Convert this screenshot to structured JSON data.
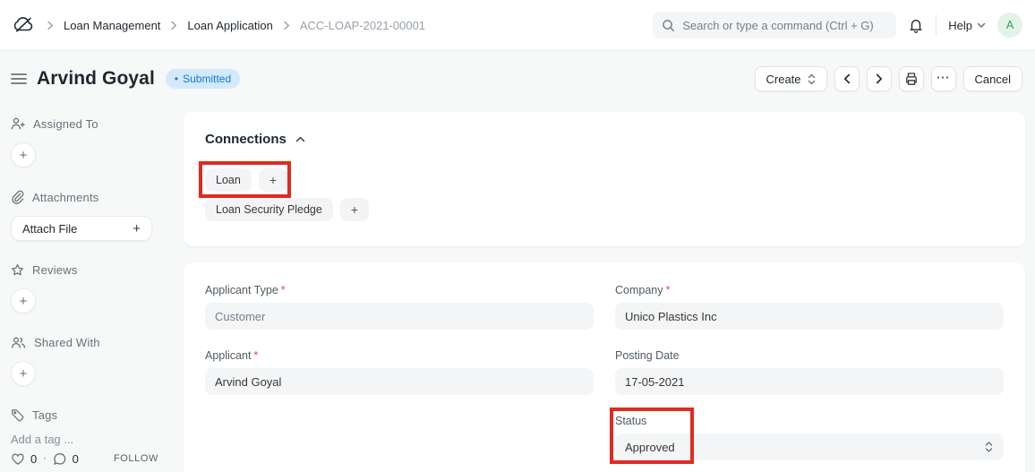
{
  "icons": {
    "plus": "+",
    "ellipsis": "⋯",
    "dot": "•",
    "separator": "·"
  },
  "colors": {
    "annotation_red": "#e02b20",
    "badge_bg": "#d3e9fc",
    "badge_text": "#1579d0",
    "field_bg": "#f4f5f6",
    "avatar_bg": "#e2f3e8",
    "avatar_text": "#2f9d5f",
    "required_asterisk": "#e24c4c"
  },
  "navbar": {
    "breadcrumbs": [
      "Loan Management",
      "Loan Application",
      "ACC-LOAP-2021-00001"
    ],
    "search_placeholder": "Search or type a command (Ctrl + G)",
    "help_label": "Help",
    "avatar_initial": "A"
  },
  "header": {
    "title": "Arvind Goyal",
    "status_badge": "Submitted",
    "create_label": "Create",
    "cancel_label": "Cancel"
  },
  "sidebar": {
    "assigned_to": "Assigned To",
    "attachments": "Attachments",
    "attach_file": "Attach File",
    "reviews": "Reviews",
    "shared_with": "Shared With",
    "tags": "Tags",
    "add_tag": "Add a tag ...",
    "likes": "0",
    "comments": "0",
    "follow": "FOLLOW"
  },
  "connections": {
    "title": "Connections",
    "links": [
      {
        "label": "Loan"
      },
      {
        "label": "Loan Security Pledge"
      }
    ]
  },
  "form": {
    "required_marker": "*",
    "applicant_type": {
      "label": "Applicant Type",
      "value": "Customer"
    },
    "company": {
      "label": "Company",
      "value": "Unico Plastics Inc"
    },
    "applicant": {
      "label": "Applicant",
      "value": "Arvind Goyal"
    },
    "posting_date": {
      "label": "Posting Date",
      "value": "17-05-2021"
    },
    "status": {
      "label": "Status",
      "value": "Approved"
    }
  }
}
